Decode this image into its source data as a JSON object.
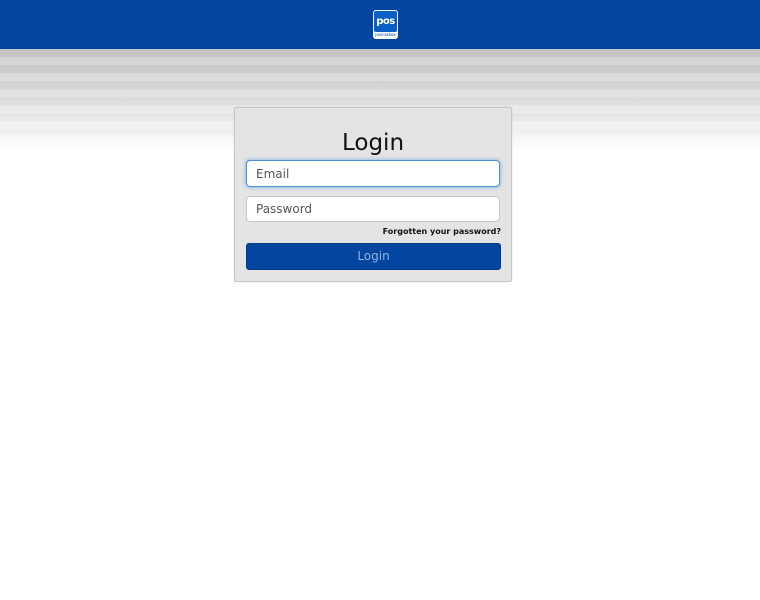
{
  "header": {
    "logo_text": "pos",
    "logo_subtext": "posinabox",
    "background_color": "#0145a0"
  },
  "login_form": {
    "title": "Login",
    "email_placeholder": "Email",
    "email_value": "",
    "password_placeholder": "Password",
    "password_value": "",
    "forgot_password_label": "Forgotten your password?",
    "submit_label": "Login",
    "accent_color": "#0145a0"
  }
}
